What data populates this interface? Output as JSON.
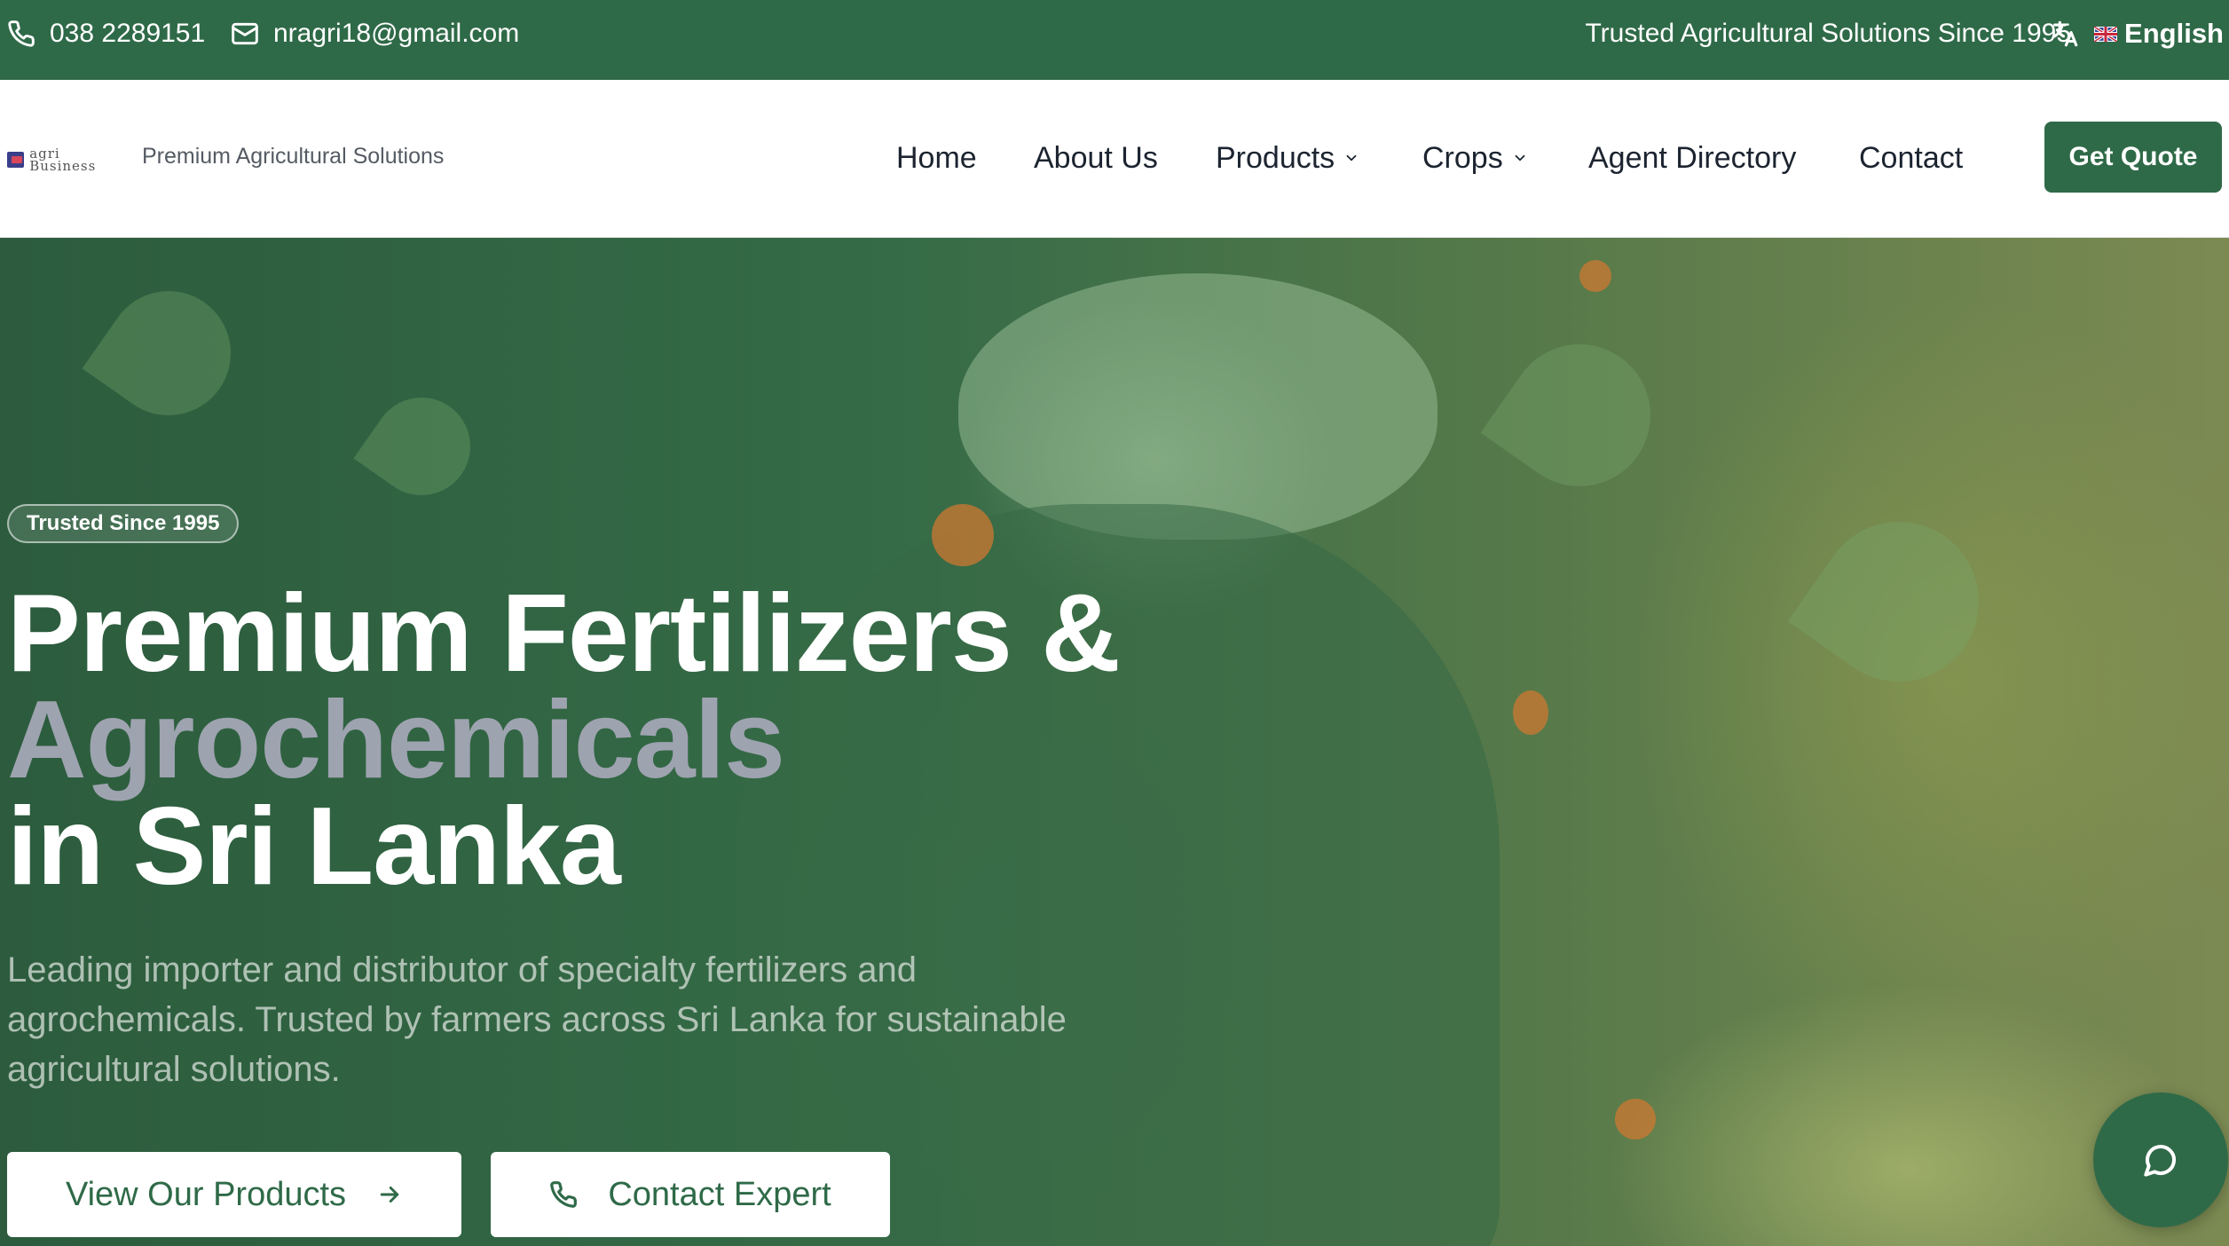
{
  "topbar": {
    "phone": "038 2289151",
    "email": "nragri18@gmail.com",
    "tagline": "Trusted Agricultural Solutions Since 1995",
    "language": "English",
    "icons": {
      "phone": "phone-icon",
      "email": "mail-icon",
      "translate": "translate-icon",
      "flag": "uk-flag-icon"
    }
  },
  "header": {
    "logo_text": "agri Business",
    "tagline": "Premium Agricultural Solutions",
    "nav": {
      "home": "Home",
      "about": "About Us",
      "products": "Products",
      "crops": "Crops",
      "agent_directory": "Agent Directory",
      "contact": "Contact"
    },
    "cta": "Get Quote"
  },
  "hero": {
    "badge": "Trusted Since 1995",
    "title_line1": "Premium Fertilizers &",
    "title_line2": "Agrochemicals",
    "title_line3": "in Sri Lanka",
    "description": "Leading importer and distributor of specialty fertilizers and agrochemicals. Trusted by farmers across Sri Lanka for sustainable agricultural solutions.",
    "primary_button": "View Our Products",
    "secondary_button": "Contact Expert"
  },
  "colors": {
    "brand_green": "#2f6a48",
    "title_accent": "#9ea3b0",
    "text_dark": "#1c2430"
  }
}
